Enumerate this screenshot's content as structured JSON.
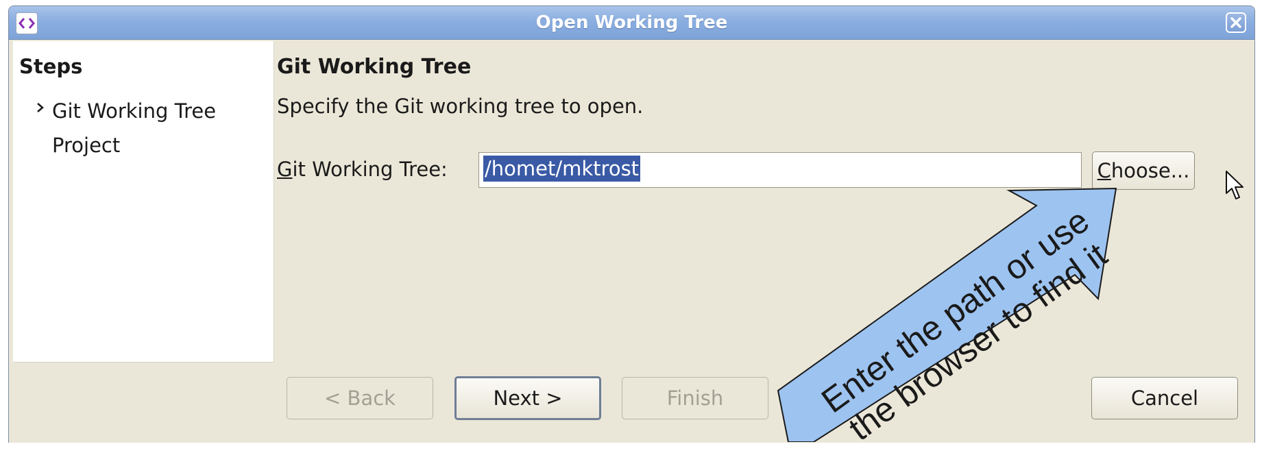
{
  "window": {
    "title": "Open Working Tree",
    "colors": {
      "titlebar": "#8aaee0",
      "background": "#ebe7d8",
      "selection": "#3a5aa6",
      "callout": "#9dc3f0"
    }
  },
  "icons": {
    "app": "code-brackets-icon",
    "close": "close-icon",
    "step_marker": "chevron-right-icon",
    "pointer": "mouse-pointer-icon"
  },
  "steps": {
    "heading": "Steps",
    "items": [
      {
        "label": "Git Working Tree Project",
        "current": true
      }
    ]
  },
  "page": {
    "title": "Git Working Tree",
    "description": "Specify the Git working tree to open."
  },
  "field": {
    "label_mnemonic": "G",
    "label_rest": "it Working Tree:",
    "value": "/homet/mktrost"
  },
  "buttons": {
    "choose_mnemonic": "C",
    "choose_rest": "hoose...",
    "back": "< Back",
    "next": "Next >",
    "finish": "Finish",
    "cancel": "Cancel"
  },
  "callout": {
    "line1": "Enter the path or use",
    "line2": "the browser to find it"
  }
}
